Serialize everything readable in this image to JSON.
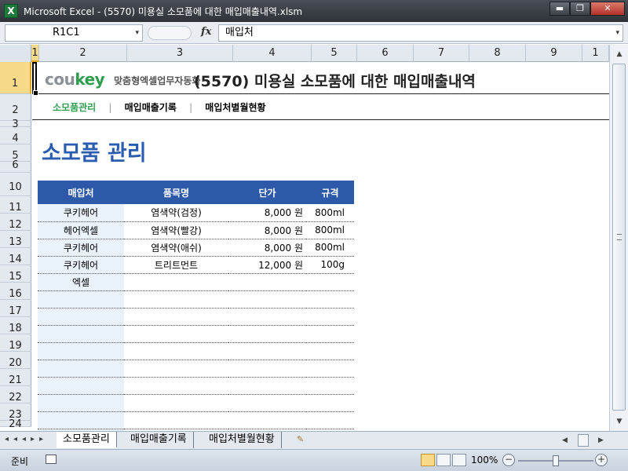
{
  "window": {
    "title": "Microsoft Excel - (5570) 미용실 소모품에 대한 매입매출내역.xlsm",
    "app_icon_letter": "X",
    "min_symbol": "▬",
    "max_symbol": "❐",
    "close_symbol": "✕"
  },
  "formula_bar": {
    "name_box": "R1C1",
    "fx_label": "fx",
    "formula": "매입처",
    "dropdown_symbol": "▾"
  },
  "columns": [
    "1",
    "2",
    "3",
    "4",
    "5",
    "6",
    "7",
    "8",
    "9",
    "1"
  ],
  "rows": [
    "1",
    "2",
    "3",
    "4",
    "5",
    "6",
    "10",
    "11",
    "12",
    "13",
    "14",
    "15",
    "16",
    "17",
    "18",
    "19",
    "20",
    "21",
    "22",
    "23",
    "24"
  ],
  "header": {
    "logo_main": "cou",
    "logo_accent": "key",
    "tagline": "맞춤형엑셀업무자동화",
    "doc_title": "(5570) 미용실 소모품에 대한 매입매출내역"
  },
  "nav": {
    "items": [
      "소모품관리",
      "매입매출기록",
      "매입처별월현황"
    ],
    "separator": "|"
  },
  "section_title": "소모품 관리",
  "table": {
    "headers": [
      "매입처",
      "품목명",
      "단가",
      "규격"
    ],
    "rows": [
      [
        "쿠키헤어",
        "염색약(검정)",
        "8,000 원",
        "800ml"
      ],
      [
        "헤어엑셀",
        "염색약(빨강)",
        "8,000 원",
        "800ml"
      ],
      [
        "쿠키헤어",
        "염색약(애쉬)",
        "8,000 원",
        "800ml"
      ],
      [
        "쿠키헤어",
        "트리트먼트",
        "12,000 원",
        "100g"
      ],
      [
        "엑셀",
        "",
        "",
        ""
      ],
      [
        "",
        "",
        "",
        ""
      ],
      [
        "",
        "",
        "",
        ""
      ],
      [
        "",
        "",
        "",
        ""
      ],
      [
        "",
        "",
        "",
        ""
      ],
      [
        "",
        "",
        "",
        ""
      ],
      [
        "",
        "",
        "",
        ""
      ],
      [
        "",
        "",
        "",
        ""
      ],
      [
        "",
        "",
        "",
        ""
      ],
      [
        "",
        "",
        "",
        ""
      ]
    ]
  },
  "sheet_tabs": [
    "소모품관리",
    "매입매출기록",
    "매입처별월현황"
  ],
  "tab_nav_symbols": "◂◂◂▸▸",
  "status": {
    "ready": "준비",
    "zoom": "100%",
    "zoom_minus": "−",
    "zoom_plus": "+",
    "zoom_level_percent": 100
  }
}
